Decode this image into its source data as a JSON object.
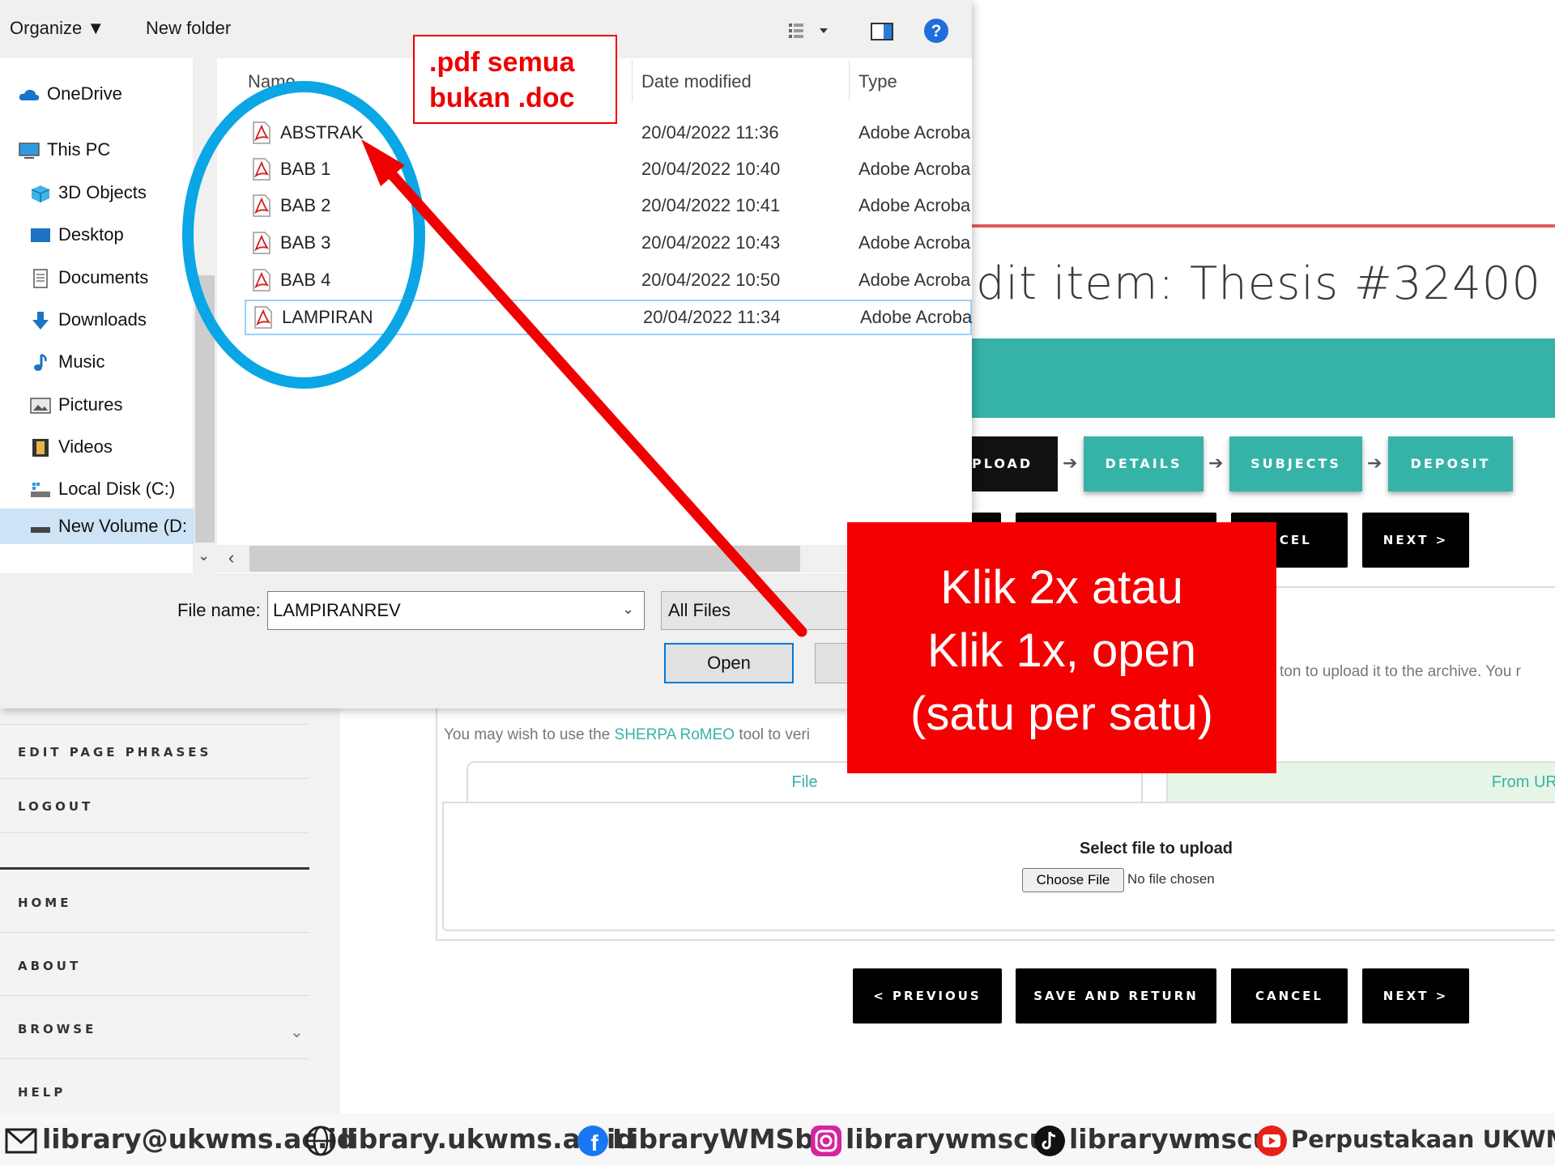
{
  "dialog": {
    "toolbar": {
      "organize": "Organize ▼",
      "new_folder": "New folder"
    },
    "nav_items": [
      "OneDrive",
      "This PC",
      "3D Objects",
      "Desktop",
      "Documents",
      "Downloads",
      "Music",
      "Pictures",
      "Videos",
      "Local Disk (C:)",
      "New Volume (D:"
    ],
    "columns": {
      "name": "Name",
      "date": "Date modified",
      "type": "Type"
    },
    "files": [
      {
        "name": "ABSTRAK",
        "date": "20/04/2022 11:36",
        "type": "Adobe Acroba"
      },
      {
        "name": "BAB 1",
        "date": "20/04/2022 10:40",
        "type": "Adobe Acroba"
      },
      {
        "name": "BAB 2",
        "date": "20/04/2022 10:41",
        "type": "Adobe Acroba"
      },
      {
        "name": "BAB 3",
        "date": "20/04/2022 10:43",
        "type": "Adobe Acroba"
      },
      {
        "name": "BAB 4",
        "date": "20/04/2022 10:50",
        "type": "Adobe Acroba"
      },
      {
        "name": "LAMPIRAN",
        "date": "20/04/2022 11:34",
        "type": "Adobe Acroba"
      }
    ],
    "file_name_label": "File name:",
    "file_name_value": "LAMPIRANREV",
    "filter": "All Files",
    "open_label": "Open"
  },
  "annotations": {
    "note_line1": ".pdf semua",
    "note_line2": "bukan .doc",
    "panel_line1": "Klik 2x atau",
    "panel_line2": "Klik 1x, open",
    "panel_line3": "(satu per satu)"
  },
  "page": {
    "title": "dit item: Thesis #32400",
    "steps": [
      "UPLOAD",
      "DETAILS",
      "SUBJECTS",
      "DEPOSIT"
    ],
    "top_buttons": {
      "cancel": "NCEL",
      "next": "NEXT >"
    },
    "info_text": "ton to upload it to the archive. You r",
    "sherpa_prefix": "You may wish to use the ",
    "sherpa_link": "SHERPA RoMEO",
    "sherpa_suffix": " tool to veri",
    "tab_file": "File",
    "tab_url": "From URL",
    "select_label": "Select file to upload",
    "choose_file": "Choose File",
    "no_file": "No file chosen",
    "bottom_buttons": {
      "previous": "< PREVIOUS",
      "save": "SAVE AND RETURN",
      "cancel": "CANCEL",
      "next": "NEXT >"
    },
    "sidebar": [
      "EDIT PAGE PHRASES",
      "LOGOUT",
      "HOME",
      "ABOUT",
      "BROWSE",
      "HELP"
    ]
  },
  "footer": {
    "email": "library@ukwms.ac.id",
    "web": "library.ukwms.ac.id",
    "facebook": "LibraryWMSby",
    "instagram": "librarywmscu",
    "tiktok": "librarywmscu",
    "youtube": "Perpustakaan UKWMS"
  },
  "colors": {
    "teal": "#36b3a8",
    "annotation_red": "#f50000",
    "ellipse_blue": "#0aa6e6"
  }
}
